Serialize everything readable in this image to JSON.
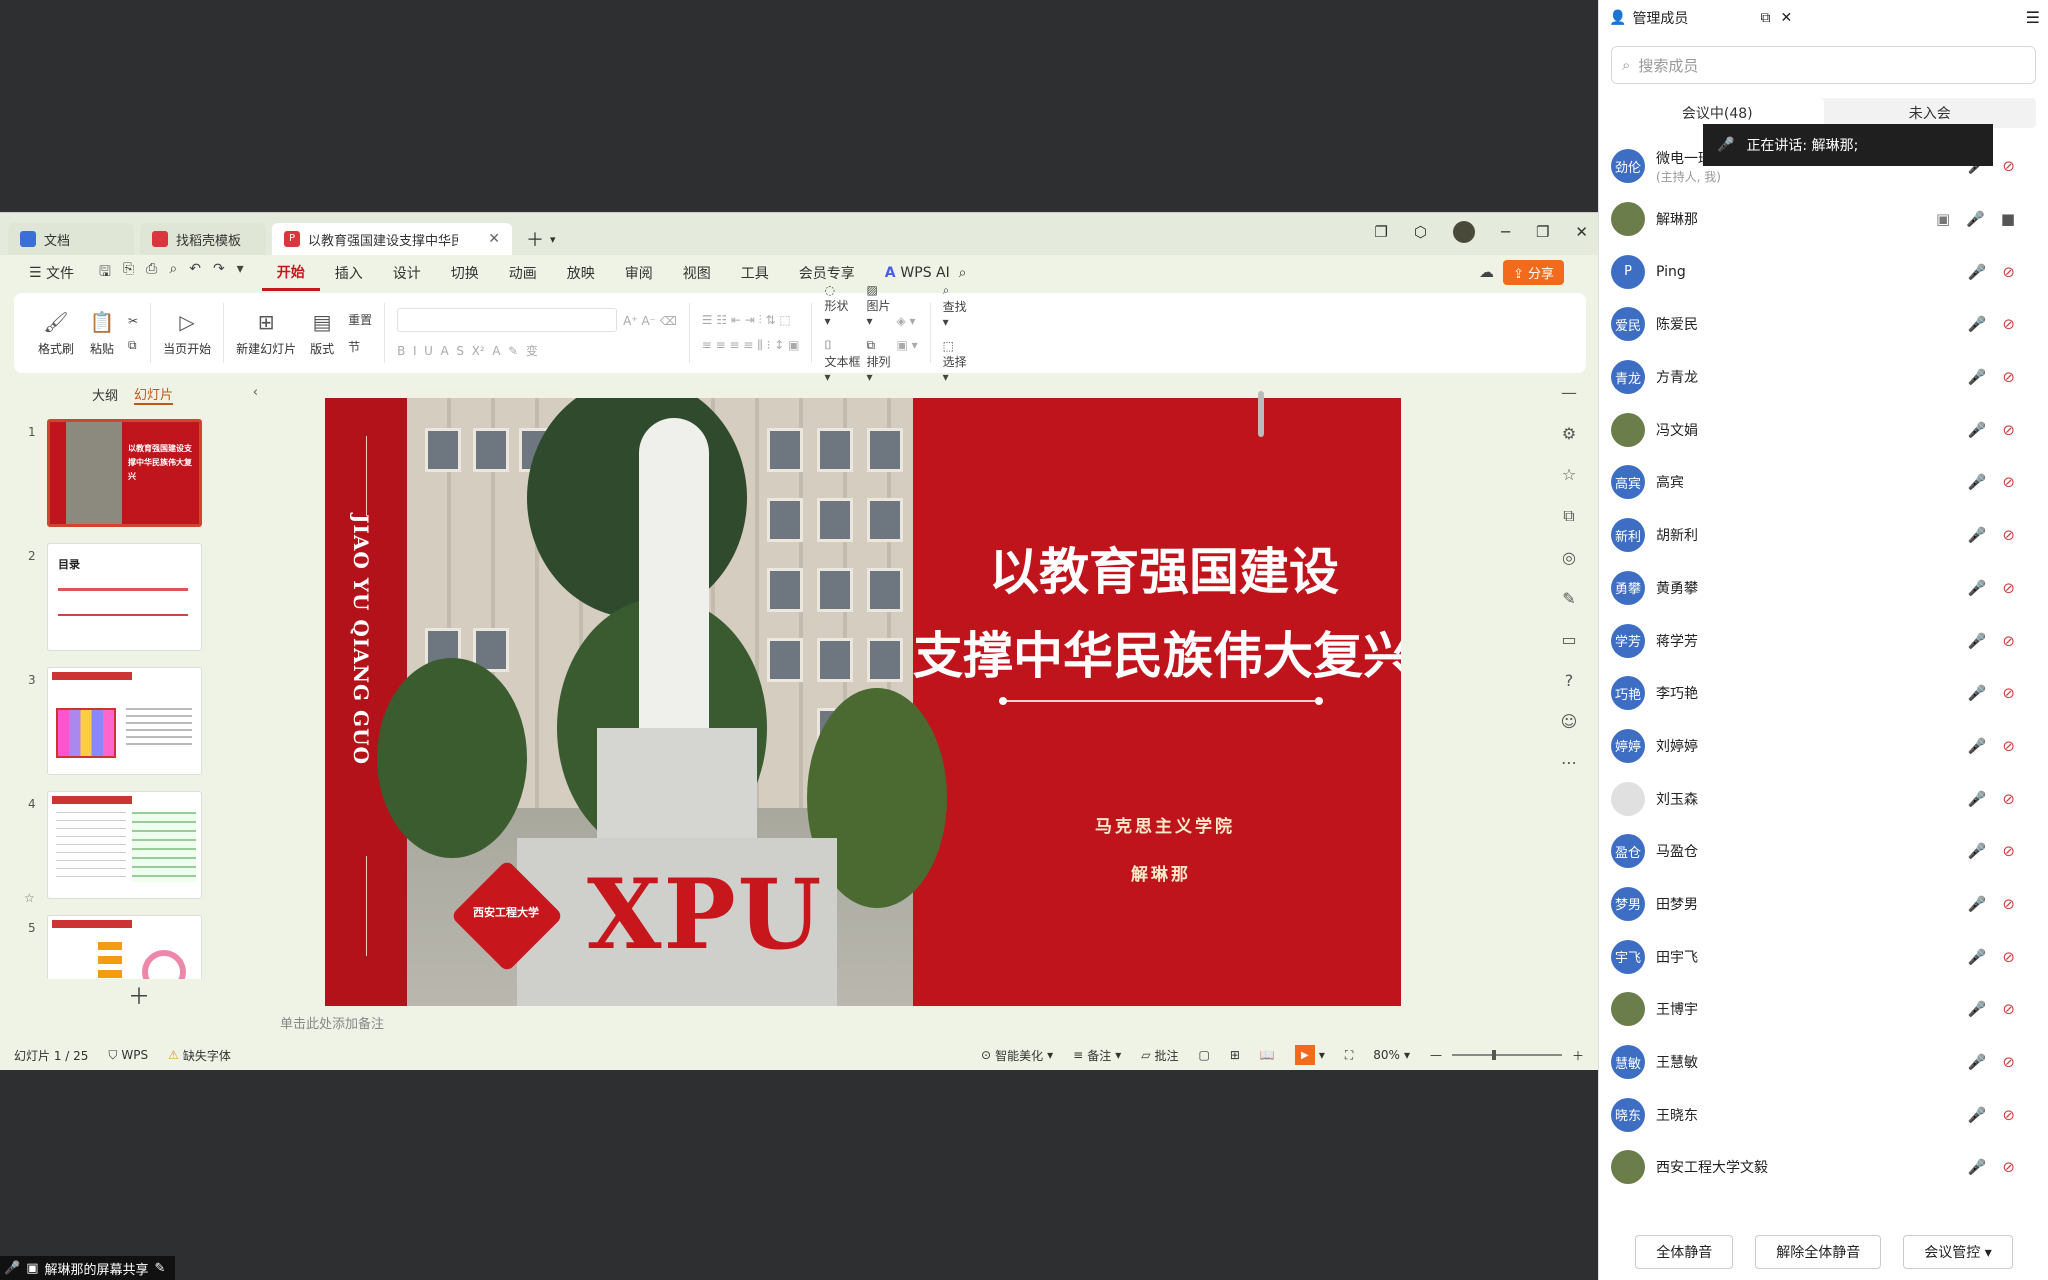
{
  "tabs": [
    {
      "label": "文档"
    },
    {
      "label": "找稻壳模板"
    },
    {
      "label": "以教育强国建设支撑中华民族"
    }
  ],
  "menus": {
    "file": "文件",
    "items": [
      "开始",
      "插入",
      "设计",
      "切换",
      "动画",
      "放映",
      "审阅",
      "视图",
      "工具",
      "会员专享"
    ],
    "wps_ai": "WPS AI",
    "share": "分享"
  },
  "ribbon": {
    "format_painter": "格式刷",
    "paste": "粘贴",
    "from_start": "当页开始",
    "new_slide": "新建幻灯片",
    "layout": "版式",
    "reset": "重置",
    "section": "节",
    "shape": "形状",
    "picture": "图片",
    "textbox": "文本框",
    "arrange": "排列",
    "find": "查找",
    "select": "选择"
  },
  "left_pane": {
    "outline": "大纲",
    "slides": "幻灯片",
    "thumbs": [
      {
        "n": "1",
        "title": "以教育强国建设支撑中华民族伟大复兴"
      },
      {
        "n": "2",
        "title": "目录"
      },
      {
        "n": "3",
        "title": ""
      },
      {
        "n": "4",
        "title": ""
      },
      {
        "n": "5",
        "title": ""
      }
    ]
  },
  "slide": {
    "vertical_text": "JIAO YU QIANG GUO",
    "title_line1": "以教育强国建设",
    "title_line2": "支撑中华民族伟大复兴",
    "subtitle1": "马克思主义学院",
    "subtitle2": "解琳那",
    "logo_text": "XPU",
    "emblem_text": "西安工程大学"
  },
  "notes_placeholder": "单击此处添加备注",
  "status": {
    "slide_counter": "幻灯片 1 / 25",
    "wps": "WPS",
    "missing_font": "缺失字体",
    "beautify": "智能美化",
    "notes": "备注",
    "comments": "批注",
    "zoom": "80%"
  },
  "panel": {
    "title": "管理成员",
    "search_placeholder": "搜索成员",
    "tab_in": "会议中(48)",
    "tab_out": "未入会",
    "speaking": "正在讲话:  解琳那;",
    "members": [
      {
        "avatar": "劲伦",
        "name": "微电一班",
        "sub": "(主持人, 我)",
        "mic": "off",
        "cam": "off"
      },
      {
        "avatar": "",
        "name": "解琳那",
        "sub": "",
        "mic": "on",
        "cam": "on"
      },
      {
        "avatar": "P",
        "name": "Ping",
        "sub": "",
        "mic": "off",
        "cam": "off"
      },
      {
        "avatar": "爱民",
        "name": "陈爱民",
        "sub": "",
        "mic": "off",
        "cam": "off"
      },
      {
        "avatar": "青龙",
        "name": "方青龙",
        "sub": "",
        "mic": "off",
        "cam": "off"
      },
      {
        "avatar": "",
        "name": "冯文娟",
        "sub": "",
        "mic": "off",
        "cam": "off"
      },
      {
        "avatar": "高宾",
        "name": "高宾",
        "sub": "",
        "mic": "off",
        "cam": "off"
      },
      {
        "avatar": "新利",
        "name": "胡新利",
        "sub": "",
        "mic": "off",
        "cam": "off"
      },
      {
        "avatar": "勇攀",
        "name": "黄勇攀",
        "sub": "",
        "mic": "off",
        "cam": "off"
      },
      {
        "avatar": "学芳",
        "name": "蒋学芳",
        "sub": "",
        "mic": "off",
        "cam": "off"
      },
      {
        "avatar": "巧艳",
        "name": "李巧艳",
        "sub": "",
        "mic": "off",
        "cam": "off"
      },
      {
        "avatar": "婷婷",
        "name": "刘婷婷",
        "sub": "",
        "mic": "off",
        "cam": "off"
      },
      {
        "avatar": "",
        "name": "刘玉森",
        "sub": "",
        "mic": "off",
        "cam": "off"
      },
      {
        "avatar": "盈仓",
        "name": "马盈仓",
        "sub": "",
        "mic": "off",
        "cam": "off"
      },
      {
        "avatar": "梦男",
        "name": "田梦男",
        "sub": "",
        "mic": "off",
        "cam": "off"
      },
      {
        "avatar": "宇飞",
        "name": "田宇飞",
        "sub": "",
        "mic": "off",
        "cam": "off"
      },
      {
        "avatar": "",
        "name": "王博宇",
        "sub": "",
        "mic": "off",
        "cam": "off"
      },
      {
        "avatar": "慧敏",
        "name": "王慧敏",
        "sub": "",
        "mic": "off",
        "cam": "off"
      },
      {
        "avatar": "晓东",
        "name": "王晓东",
        "sub": "",
        "mic": "off",
        "cam": "off"
      },
      {
        "avatar": "",
        "name": "西安工程大学文毅",
        "sub": "",
        "mic": "off",
        "cam": "off"
      }
    ],
    "mute_all": "全体静音",
    "unmute_all": "解除全体静音",
    "meeting_ctrl": "会议管控"
  },
  "share_indicator": "解琳那的屏幕共享",
  "colors": {
    "accent": "#c8161d",
    "share": "#f26b1d",
    "avatar": "#3d6ec4"
  }
}
